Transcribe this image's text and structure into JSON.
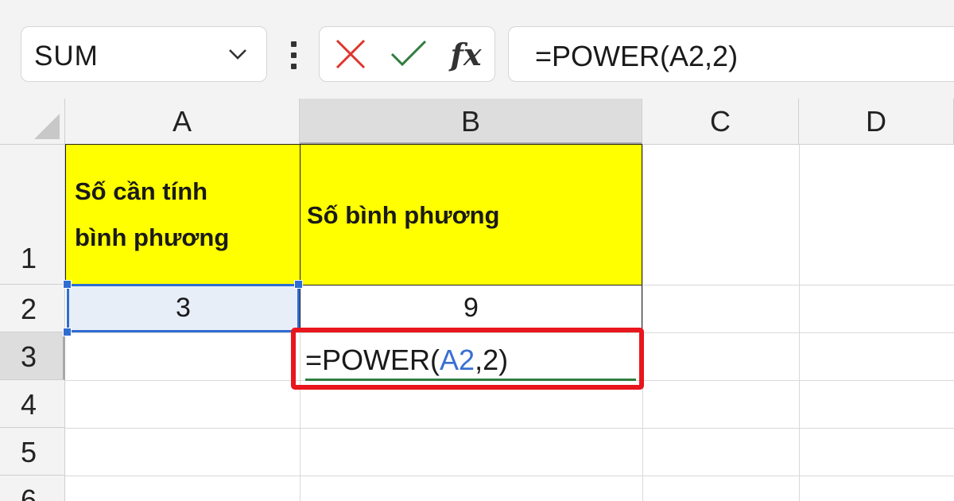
{
  "name_box": {
    "value": "SUM"
  },
  "formula_bar": {
    "fx_label": "fx",
    "value": "=POWER(A2,2)"
  },
  "columns": [
    "A",
    "B",
    "C",
    "D"
  ],
  "rows": [
    "1",
    "2",
    "3",
    "4",
    "5",
    "6"
  ],
  "cells": {
    "A1": "Số cần tính bình phương",
    "A1_line1": "Số cần tính",
    "A1_line2": "bình phương",
    "B1": "Số bình phương",
    "A2": "3",
    "B2": "9"
  },
  "editing_cell": {
    "address": "B3",
    "prefix": "=POWER(",
    "reference": "A2",
    "suffix": ",2)"
  },
  "colors": {
    "header_fill": "#ffff00",
    "selection": "#2f6dd0",
    "highlight_box": "#e8161d",
    "cancel_icon": "#e0342c",
    "enter_icon": "#2f7d3e",
    "reference_text": "#3a6fd3"
  }
}
